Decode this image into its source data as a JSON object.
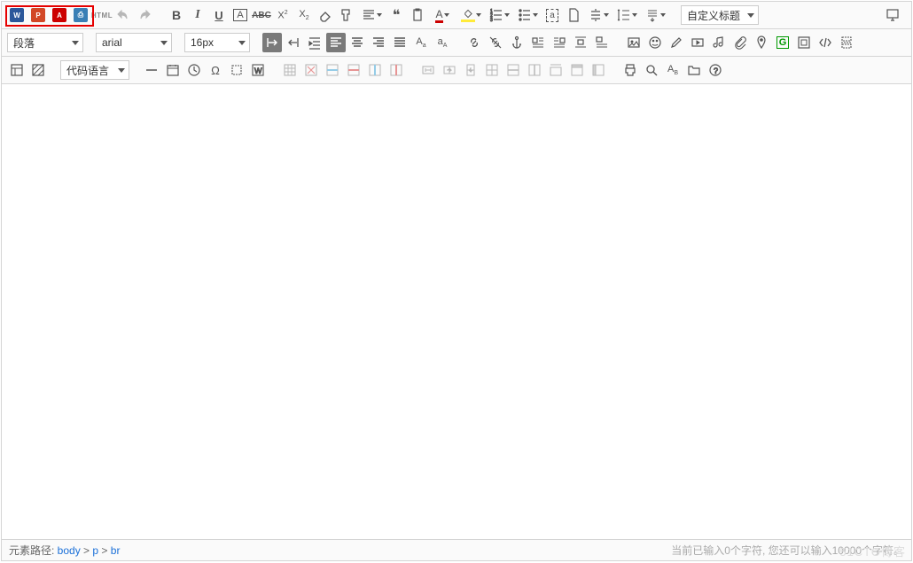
{
  "dropdowns": {
    "custom_title": "自定义标题",
    "paragraph": "段落",
    "font_family": "arial",
    "font_size": "16px",
    "code_lang": "代码语言"
  },
  "html_label": "HTML",
  "doc_icons": {
    "word": "W",
    "ppt": "P",
    "pdf": "A",
    "print": "⎙"
  },
  "status": {
    "path_label": "元素路径: ",
    "path_parts": [
      "body",
      "p",
      "br"
    ],
    "sep": " > ",
    "counter": "当前已输入0个字符, 您还可以输入10000个字符。"
  },
  "watermark": "51CTO博客"
}
